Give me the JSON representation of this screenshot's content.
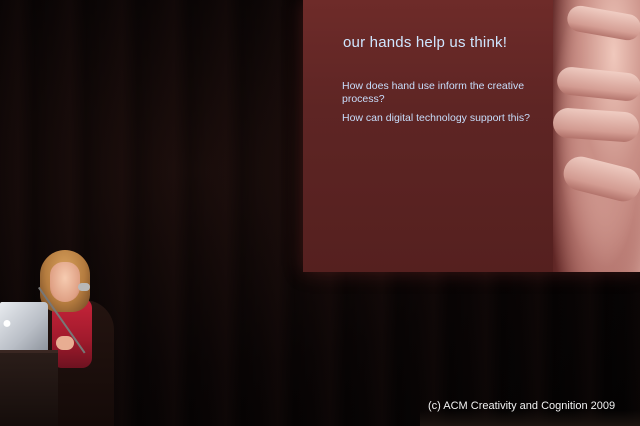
{
  "slide": {
    "title": "our hands help us think!",
    "question_1": "How does hand use inform the creative process?",
    "question_2": "How can digital technology support this?"
  },
  "caption": "(c) ACM Creativity and Cognition 2009",
  "icons": {
    "laptop_logo": "apple-logo-icon"
  },
  "colors": {
    "slide_background": "#5e2524",
    "slide_text": "#cfe6ff",
    "stage_background": "#0a0505",
    "scarf": "#c8243a"
  }
}
